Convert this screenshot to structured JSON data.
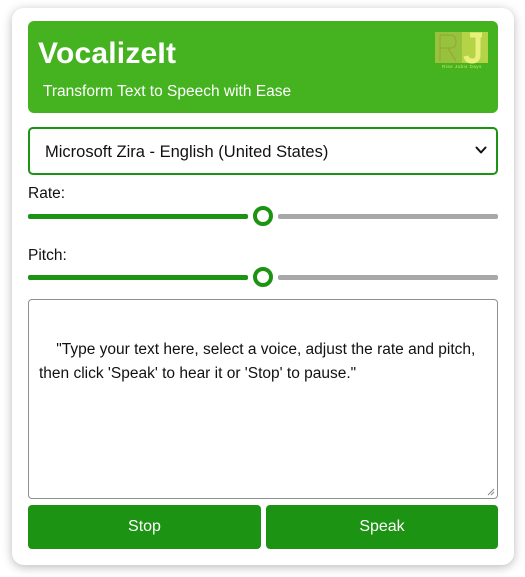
{
  "app": {
    "title": "VocalizeIt",
    "subtitle": "Transform Text to Speech with Ease",
    "logo_text": "RJ",
    "logo_tag": "Rise Jubis Days"
  },
  "voice": {
    "selected": "Microsoft Zira - English (United States)"
  },
  "rate": {
    "label": "Rate:",
    "value_fraction": 0.5
  },
  "pitch": {
    "label": "Pitch:",
    "value_fraction": 0.5
  },
  "text_input": {
    "value": "\"Type your text here, select a voice, adjust the rate and pitch, then click 'Speak' to hear it or 'Stop' to pause.\""
  },
  "buttons": {
    "stop_label": "Stop",
    "speak_label": "Speak"
  },
  "colors": {
    "header_bg": "#45b320",
    "accent": "#1d9314",
    "track_inactive": "#a8a8a8"
  }
}
